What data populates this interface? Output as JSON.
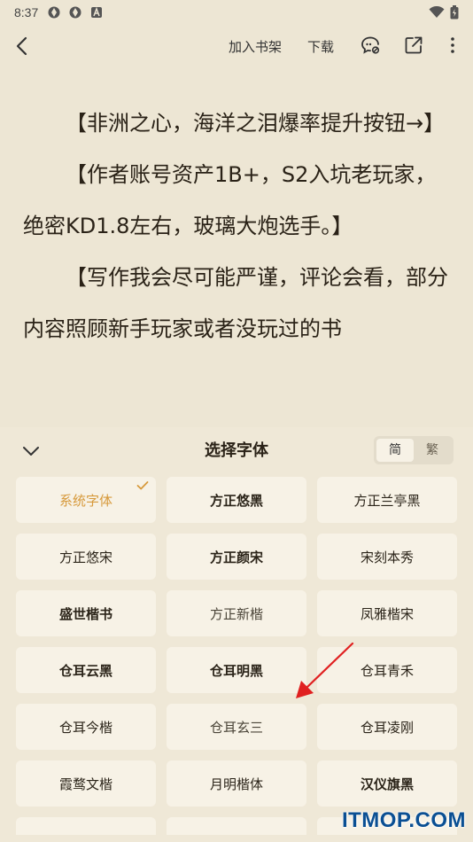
{
  "status_bar": {
    "time": "8:37"
  },
  "toolbar": {
    "add_to_shelf": "加入书架",
    "download": "下载"
  },
  "reader": {
    "paragraphs": [
      "【非洲之心，海洋之泪爆率提升按钮→】",
      "【作者账号资产1B+，S2入坑老玩家，绝密KD1.8左右，玻璃大炮选手。】",
      "【写作我会尽可能严谨，评论会看，部分内容照顾新手玩家或者没玩过的书"
    ]
  },
  "font_panel": {
    "title": "选择字体",
    "script_options": [
      "简",
      "繁"
    ],
    "active_script": "简",
    "fonts": [
      "系统字体",
      "方正悠黑",
      "方正兰亭黑",
      "方正悠宋",
      "方正颜宋",
      "宋刻本秀",
      "盛世楷书",
      "方正新楷",
      "凤雅楷宋",
      "仓耳云黑",
      "仓耳明黑",
      "仓耳青禾",
      "仓耳今楷",
      "仓耳玄三",
      "仓耳凌刚",
      "霞鹜文楷",
      "月明楷体",
      "汉仪旗黑"
    ],
    "selected_font": "系统字体"
  },
  "watermark": "ITMOP.COM",
  "colors": {
    "background": "#ede6d4",
    "card": "#f7f2e6",
    "accent": "#d79a3c",
    "arrow": "#e02020"
  }
}
